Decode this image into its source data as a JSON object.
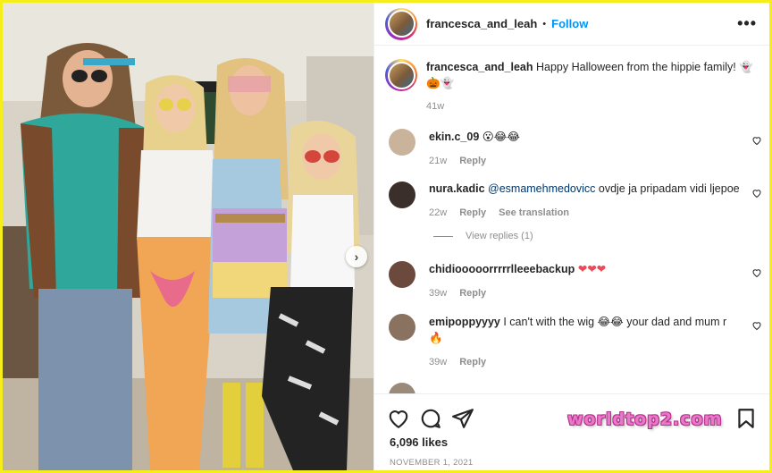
{
  "post": {
    "username": "francesca_and_leah",
    "separator": "•",
    "follow_label": "Follow",
    "more_label": "•••",
    "next_label": "›",
    "photo_alt": "Family in hippie Halloween costumes"
  },
  "caption": {
    "username": "francesca_and_leah",
    "text": "Happy Halloween from the hippie family!",
    "emoji_1": "👻",
    "emoji_2": "🎃👻",
    "time": "41w"
  },
  "comments": [
    {
      "username": "ekin.c_09",
      "text": "",
      "emoji": "😮😂😂",
      "time": "21w",
      "reply_label": "Reply",
      "avatar_color": "#c9b39a"
    },
    {
      "username": "nura.kadic",
      "mention": "@esmamehmedovicc",
      "text": " ovdje ja pripadam vidi ljepoe",
      "time": "22w",
      "reply_label": "Reply",
      "translate_label": "See translation",
      "avatar_color": "#3a2f2a"
    },
    {
      "username": "chidiooooorrrrrlleeebackup",
      "text": "",
      "emoji": "❤❤❤",
      "time": "39w",
      "reply_label": "Reply",
      "avatar_color": "#6b4a3d"
    },
    {
      "username": "emipoppyyyy",
      "text": " I can't with the wig ",
      "emoji": "😂😂",
      "text_2": " your dad and mum r",
      "emoji_2": "🔥",
      "time": "39w",
      "reply_label": "Reply",
      "avatar_color": "#8a7260"
    }
  ],
  "view_replies_label": "View replies (1)",
  "likes": "6,096 likes",
  "date": "NOVEMBER 1, 2021",
  "watermark": "worldtop2.com",
  "colors": {
    "accent": "#0095f6",
    "frame": "#f6ee1a",
    "heart": "#ed4956"
  },
  "icons": [
    "heart-icon",
    "comment-icon",
    "share-icon",
    "bookmark-icon",
    "more-icon"
  ]
}
